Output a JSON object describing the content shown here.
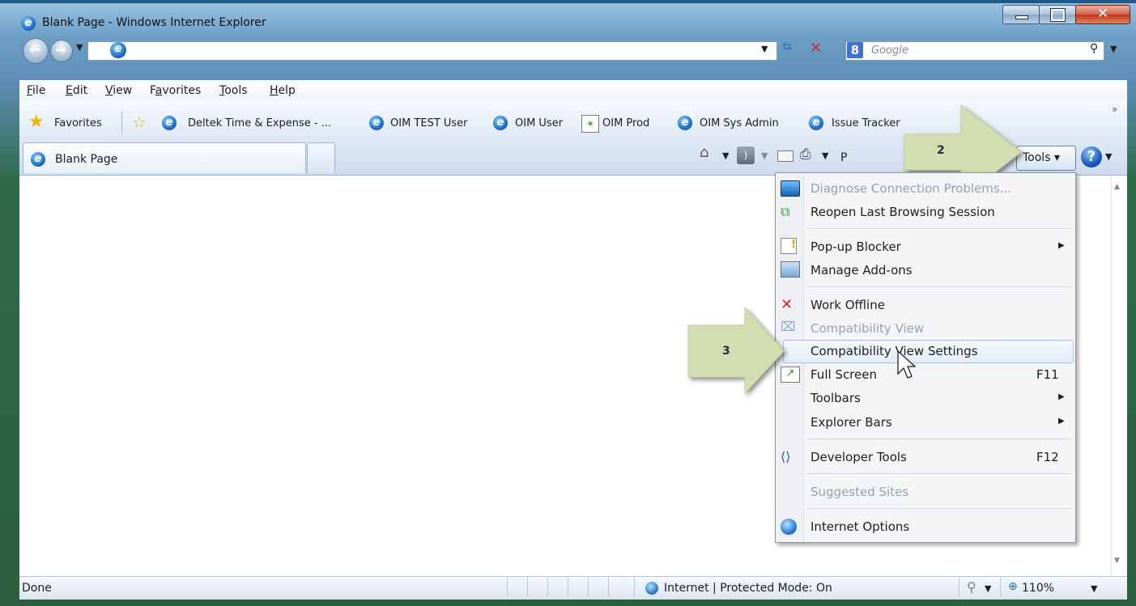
{
  "window": {
    "title": "Blank Page - Windows Internet Explorer",
    "controls": [
      "minimize",
      "maximize",
      "close"
    ]
  },
  "navigation": {
    "address_value": "",
    "search_placeholder": "Google"
  },
  "menubar": [
    {
      "label": "File",
      "key": "F",
      "rest": "ile"
    },
    {
      "label": "Edit",
      "key": "E",
      "rest": "dit"
    },
    {
      "label": "View",
      "key": "V",
      "rest": "iew"
    },
    {
      "label": "Favorites",
      "pre": "F",
      "key": "a",
      "rest": "vorites"
    },
    {
      "label": "Tools",
      "key": "T",
      "rest": "ools"
    },
    {
      "label": "Help",
      "key": "H",
      "rest": "elp"
    }
  ],
  "favorites_bar": {
    "label": "Favorites",
    "items": [
      {
        "label": "Deltek Time & Expense - ...",
        "icon": "ie-icon"
      },
      {
        "label": "OIM TEST User",
        "icon": "ie-icon"
      },
      {
        "label": "OIM User",
        "icon": "ie-icon"
      },
      {
        "label": "OIM Prod",
        "icon": "app-icon"
      },
      {
        "label": "OIM Sys Admin",
        "icon": "ie-icon"
      },
      {
        "label": "Issue Tracker",
        "icon": "ie-icon"
      }
    ],
    "more": "»"
  },
  "tabs": {
    "active_label": "Blank Page"
  },
  "command_bar": {
    "tools_label": "Tools",
    "tools_key": "o",
    "partial_text": "P"
  },
  "tools_menu": {
    "items": [
      {
        "label": "Diagnose Connection Problems...",
        "disabled": true,
        "icon": "diagnose-icon"
      },
      {
        "label": "Reopen Last Browsing Session",
        "disabled": false,
        "icon": "reopen-session-icon"
      },
      {
        "label": "Pop-up Blocker",
        "disabled": false,
        "icon": "popup-blocker-icon",
        "submenu": true
      },
      {
        "label": "Manage Add-ons",
        "disabled": false,
        "icon": "addons-icon"
      },
      {
        "label": "Work Offline",
        "disabled": false,
        "icon": "work-offline-icon"
      },
      {
        "label": "Compatibility View",
        "disabled": true,
        "icon": "compat-view-icon"
      },
      {
        "label": "Compatibility View Settings",
        "disabled": false,
        "highlighted": true
      },
      {
        "label": "Full Screen",
        "disabled": false,
        "icon": "fullscreen-icon",
        "shortcut": "F11"
      },
      {
        "label": "Toolbars",
        "disabled": false,
        "submenu": true
      },
      {
        "label": "Explorer Bars",
        "disabled": false,
        "submenu": true
      },
      {
        "label": "Developer Tools",
        "disabled": false,
        "icon": "developer-tools-icon",
        "shortcut": "F12"
      },
      {
        "label": "Suggested Sites",
        "disabled": true
      },
      {
        "label": "Internet Options",
        "disabled": false,
        "icon": "internet-options-icon"
      }
    ]
  },
  "annotations": {
    "step2": "2",
    "step3": "3"
  },
  "status_bar": {
    "text": "Done",
    "zone": "Internet | Protected Mode: On",
    "zoom": "110%"
  },
  "colors": {
    "frame_top": "#6d9fc6",
    "frame_bottom": "#2b5e3f",
    "arrow_fill": "#d2ddb0",
    "menu_highlight": "#e3ecf7"
  }
}
